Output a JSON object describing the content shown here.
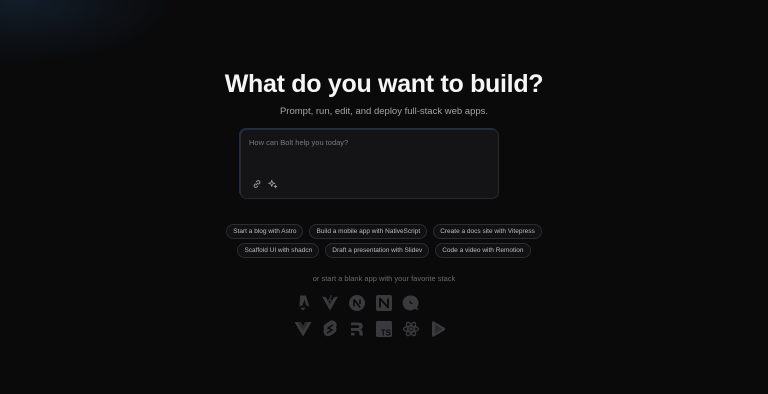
{
  "hero": {
    "title": "What do you want to build?",
    "subtitle": "Prompt, run, edit, and deploy full-stack web apps."
  },
  "prompt": {
    "placeholder": "How can Bolt help you today?",
    "value": "",
    "icons": [
      "link-icon",
      "sparkle-icon"
    ]
  },
  "suggestions": {
    "row1": [
      "Start a blog with Astro",
      "Build a mobile app with NativeScript",
      "Create a docs site with Vitepress"
    ],
    "row2": [
      "Scaffold UI with shadcn",
      "Draft a presentation with Slidev",
      "Code a video with Remotion"
    ]
  },
  "stacks": {
    "label": "or start a blank app with your favorite stack",
    "row1": [
      "astro-icon",
      "vite-icon",
      "next-icon",
      "nuxt-icon",
      "qwik-icon"
    ],
    "row2": [
      "vue-icon",
      "svelte-icon",
      "remix-icon",
      "typescript-icon",
      "react-icon",
      "remotion-icon"
    ],
    "ts_text": "TS"
  }
}
